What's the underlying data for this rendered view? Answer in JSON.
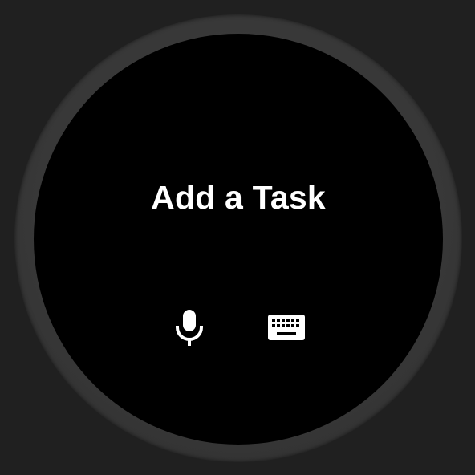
{
  "screen": {
    "title": "Add a Task"
  },
  "actions": [
    {
      "icon": "microphone-icon"
    },
    {
      "icon": "keyboard-icon"
    }
  ],
  "colors": {
    "background": "#202020",
    "bezel": "#3a3a3a",
    "screen": "#000000",
    "text": "#ffffff"
  }
}
